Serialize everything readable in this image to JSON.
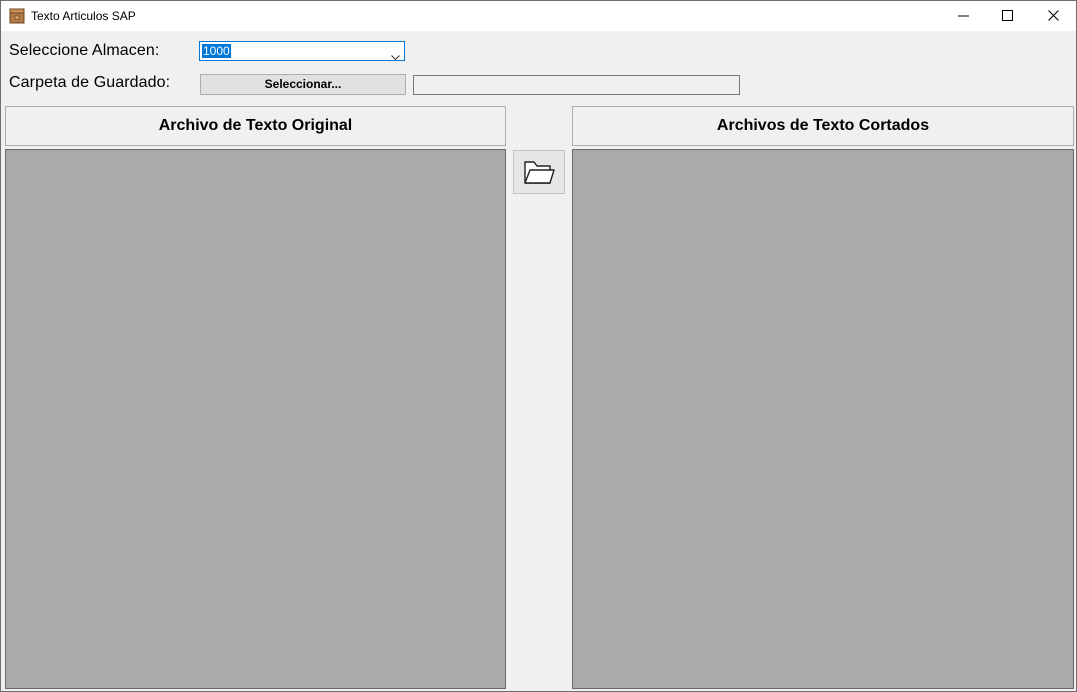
{
  "window": {
    "title": "Texto Articulos SAP",
    "icon": "package-icon"
  },
  "form": {
    "almacen_label": "Seleccione Almacen:",
    "almacen_value": "1000",
    "carpeta_label": "Carpeta de Guardado:",
    "seleccionar_button": "Seleccionar...",
    "path_value": ""
  },
  "panels": {
    "left_header": "Archivo de Texto Original",
    "right_header": "Archivos de Texto Cortados",
    "open_button_icon": "folder-open-icon"
  },
  "colors": {
    "accent": "#0078d7",
    "panel_background": "#aaaaaa",
    "window_background": "#f0f0f0"
  }
}
